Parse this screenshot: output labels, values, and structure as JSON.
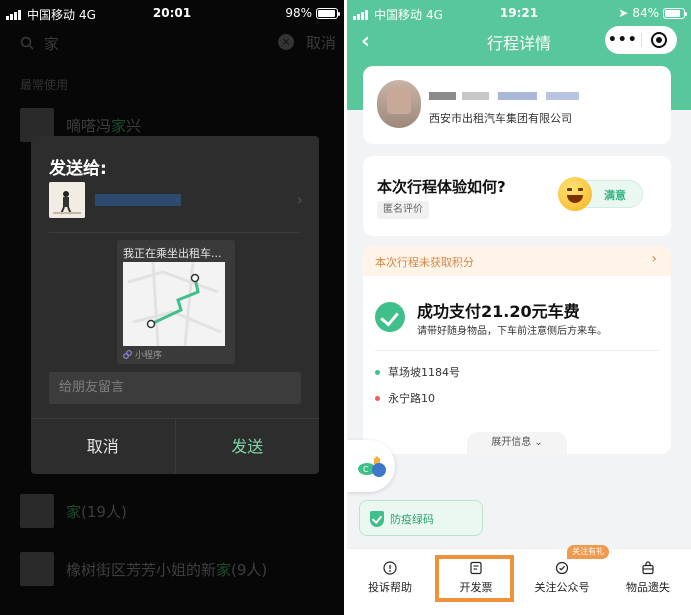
{
  "left": {
    "status": {
      "carrier": "中国移动",
      "network": "4G",
      "time": "20:01",
      "battery": "98%",
      "battery_level": 0.98
    },
    "background": {
      "search_text": "家",
      "cancel": "取消",
      "section_recent": "最常使用",
      "recent_contact": {
        "prefix": "嘀嗒冯",
        "highlight": "家",
        "suffix": "兴"
      },
      "group1": {
        "highlight": "家",
        "suffix": "(19人)"
      },
      "group2": {
        "prefix": "橡树街区芳芳小姐的新",
        "highlight": "家",
        "suffix": "(9人)"
      }
    },
    "dialog": {
      "title": "发送给:",
      "card_title": "我正在乘坐出租车...",
      "card_source": "小程序",
      "message_placeholder": "给朋友留言",
      "cancel": "取消",
      "send": "发送"
    }
  },
  "right": {
    "status": {
      "carrier": "中国移动",
      "network": "4G",
      "time": "19:21",
      "battery": "84%",
      "battery_level": 0.84
    },
    "nav": {
      "title": "行程详情",
      "more": "•••"
    },
    "driver": {
      "company": "西安市出租汽车集团有限公司"
    },
    "rating": {
      "question": "本次行程体验如何?",
      "anonymous": "匿名评价",
      "satisfied": "满意"
    },
    "points_banner": "本次行程未获取积分",
    "payment": {
      "title": "成功支付21.20元车费",
      "subtitle": "请带好随身物品，下车前注意侧后方来车。",
      "origin": "草场坡1184号",
      "destination": "永宁路10",
      "expand": "展开信息"
    },
    "health_code": "防疫绿码",
    "tabs": [
      {
        "label": "投诉帮助",
        "icon": "info-icon"
      },
      {
        "label": "开发票",
        "icon": "invoice-icon"
      },
      {
        "label": "关注公众号",
        "icon": "follow-icon",
        "badge": "关注有礼"
      },
      {
        "label": "物品遗失",
        "icon": "bag-icon"
      }
    ]
  },
  "colors": {
    "brand_green": "#58c89c",
    "accent_orange": "#f0923c",
    "dialog_bg": "#2d2d2d"
  }
}
